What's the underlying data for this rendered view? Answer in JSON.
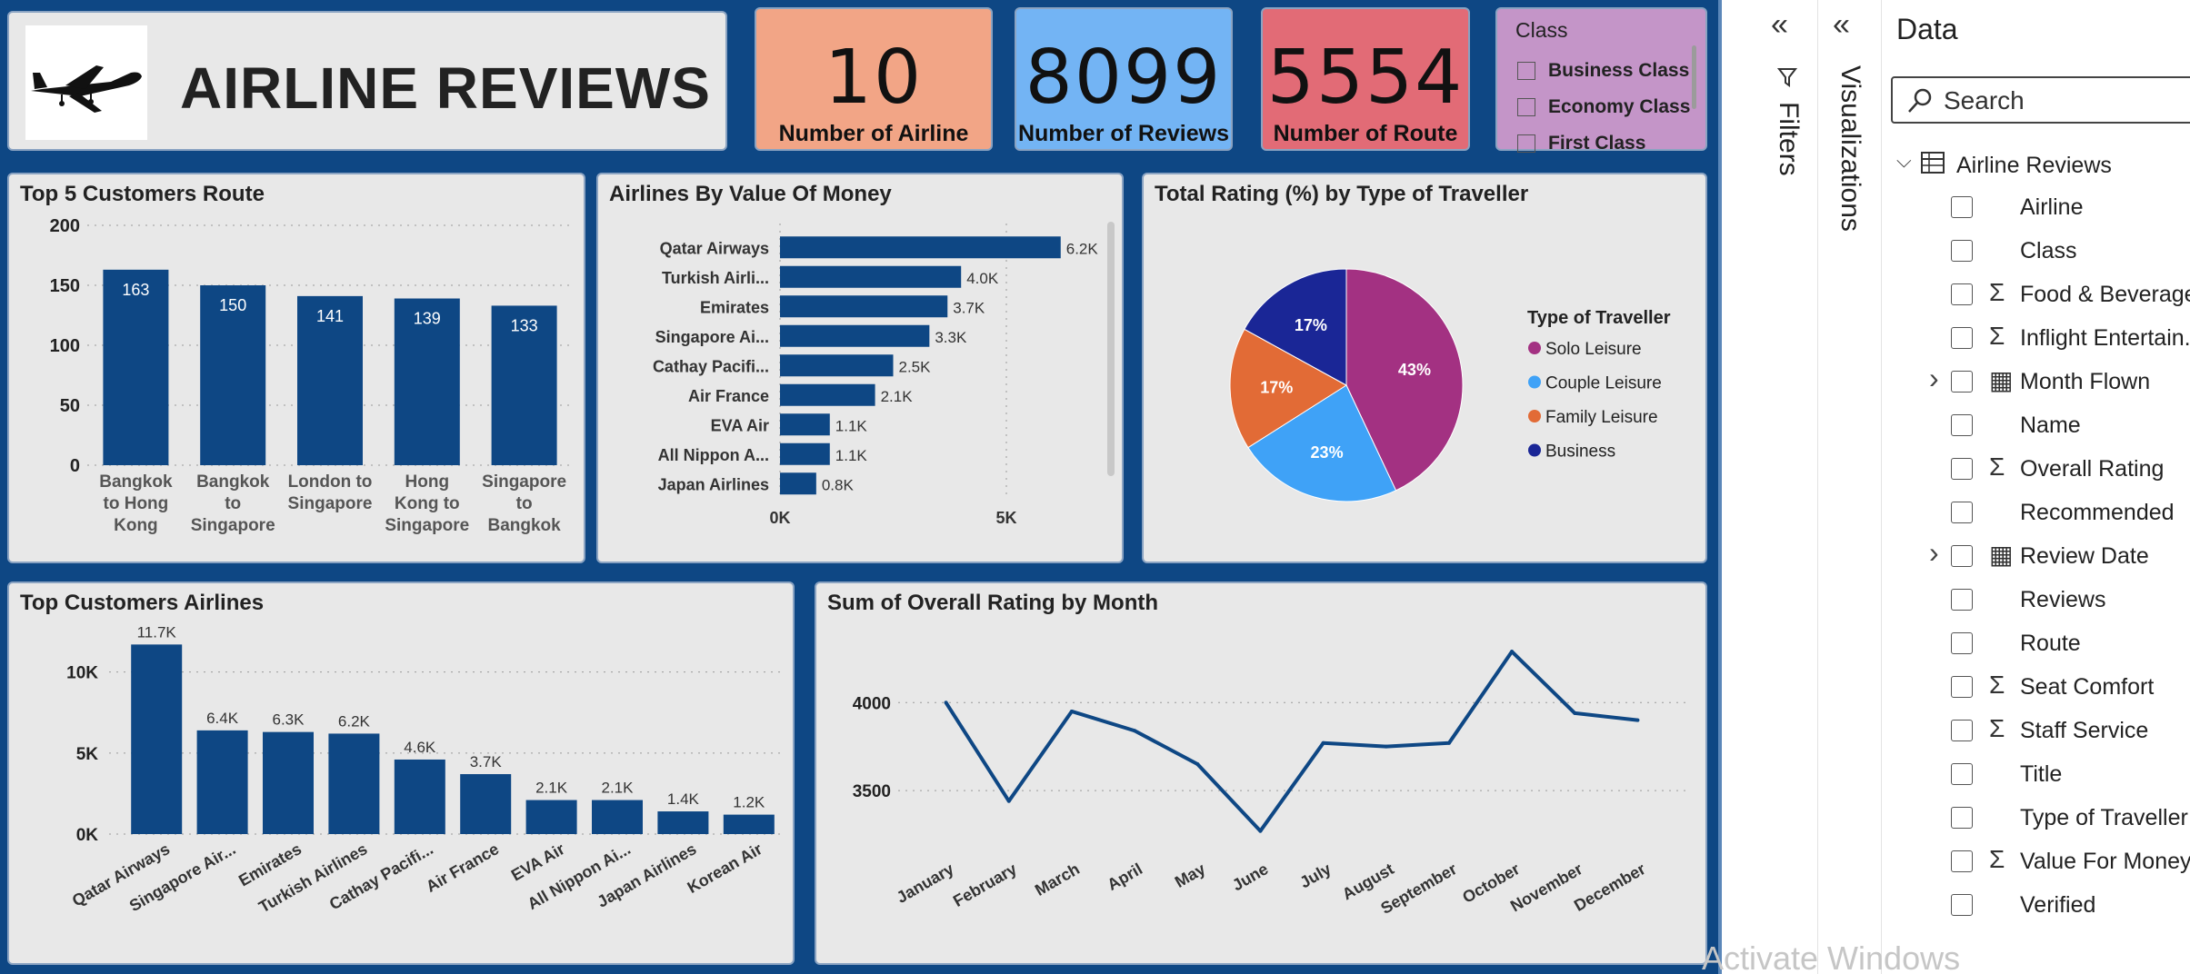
{
  "header": {
    "title": "AIRLINE REVIEWS"
  },
  "kpis": [
    {
      "value": "10",
      "label": "Number of Airline",
      "color": "#f2a586"
    },
    {
      "value": "8099",
      "label": "Number of Reviews",
      "color": "#73b4f4"
    },
    {
      "value": "5554",
      "label": "Number of Route",
      "color": "#e26b76"
    }
  ],
  "slicer": {
    "title": "Class",
    "items": [
      "Business Class",
      "Economy Class",
      "First Class"
    ]
  },
  "charts": {
    "routes": {
      "title": "Top 5 Customers Route",
      "chart_data": {
        "type": "bar",
        "categories": [
          "Bangkok to Hong Kong",
          "Bangkok to Singapore",
          "London to Singapore",
          "Hong Kong to Singapore",
          "Singapore to Bangkok"
        ],
        "category_lines": [
          [
            "Bangkok",
            "to Hong",
            "Kong"
          ],
          [
            "Bangkok",
            "to",
            "Singapore"
          ],
          [
            "London to",
            "Singapore"
          ],
          [
            "Hong",
            "Kong to",
            "Singapore"
          ],
          [
            "Singapore",
            "to",
            "Bangkok"
          ]
        ],
        "values": [
          163,
          150,
          141,
          139,
          133
        ],
        "value_labels": [
          "163",
          "150",
          "141",
          "139",
          "133"
        ],
        "yticks": [
          "0",
          "50",
          "100",
          "150",
          "200"
        ],
        "ylim": [
          0,
          200
        ],
        "color": "#0e4784"
      }
    },
    "value_money": {
      "title": "Airlines By Value Of Money",
      "chart_data": {
        "type": "bar",
        "orientation": "horizontal",
        "categories": [
          "Qatar Airways",
          "Turkish Airli...",
          "Emirates",
          "Singapore Ai...",
          "Cathay Pacifi...",
          "Air France",
          "EVA Air",
          "All Nippon A...",
          "Japan Airlines"
        ],
        "values": [
          6200,
          4000,
          3700,
          3300,
          2500,
          2100,
          1100,
          1100,
          800
        ],
        "value_labels": [
          "6.2K",
          "4.0K",
          "3.7K",
          "3.3K",
          "2.5K",
          "2.1K",
          "1.1K",
          "1.1K",
          "0.8K"
        ],
        "xticks": [
          "0K",
          "5K"
        ],
        "xlim": [
          0,
          5000
        ],
        "color": "#0e4784"
      }
    },
    "traveller": {
      "title": "Total Rating (%) by Type of Traveller",
      "chart_data": {
        "type": "pie",
        "legend_title": "Type of Traveller",
        "labels": [
          "Solo Leisure",
          "Couple Leisure",
          "Family Leisure",
          "Business"
        ],
        "values": [
          43,
          23,
          17,
          17
        ],
        "value_labels": [
          "43%",
          "23%",
          "17%",
          "17%"
        ],
        "colors": [
          "#a33182",
          "#3fa2f7",
          "#e26b36",
          "#1a2696"
        ]
      }
    },
    "airlines": {
      "title": "Top Customers Airlines",
      "chart_data": {
        "type": "bar",
        "categories": [
          "Qatar Airways",
          "Singapore Air...",
          "Emirates",
          "Turkish Airlines",
          "Cathay Pacifi...",
          "Air France",
          "EVA Air",
          "All Nippon Ai...",
          "Japan Airlines",
          "Korean Air"
        ],
        "values": [
          11700,
          6400,
          6300,
          6200,
          4600,
          3700,
          2100,
          2100,
          1400,
          1200
        ],
        "value_labels": [
          "11.7K",
          "6.4K",
          "6.3K",
          "6.2K",
          "4.6K",
          "3.7K",
          "2.1K",
          "2.1K",
          "1.4K",
          "1.2K"
        ],
        "yticks": [
          "0K",
          "5K",
          "10K"
        ],
        "ylim": [
          0,
          12000
        ],
        "color": "#0e4784"
      }
    },
    "month": {
      "title": "Sum of Overall Rating by Month",
      "chart_data": {
        "type": "line",
        "x": [
          "January",
          "February",
          "March",
          "April",
          "May",
          "June",
          "July",
          "August",
          "September",
          "October",
          "November",
          "December"
        ],
        "values": [
          4000,
          3440,
          3950,
          3840,
          3650,
          3270,
          3770,
          3750,
          3770,
          4290,
          3940,
          3900
        ],
        "yticks": [
          "3500",
          "4000"
        ],
        "ylim": [
          3180,
          4420
        ],
        "color": "#0e4784"
      }
    }
  },
  "panes": {
    "filters_label": "Filters",
    "viz_label": "Visualizations",
    "data_title": "Data",
    "search_placeholder": "Search",
    "table_name": "Airline Reviews",
    "fields": [
      {
        "name": "Airline",
        "icon": "",
        "expand": false
      },
      {
        "name": "Class",
        "icon": "",
        "expand": false
      },
      {
        "name": "Food & Beverages",
        "icon": "sigma",
        "expand": false
      },
      {
        "name": "Inflight Entertain...",
        "icon": "sigma",
        "expand": false
      },
      {
        "name": "Month Flown",
        "icon": "calendar",
        "expand": true
      },
      {
        "name": "Name",
        "icon": "",
        "expand": false
      },
      {
        "name": "Overall Rating",
        "icon": "sigma",
        "expand": false
      },
      {
        "name": "Recommended",
        "icon": "",
        "expand": false
      },
      {
        "name": "Review Date",
        "icon": "calendar",
        "expand": true
      },
      {
        "name": "Reviews",
        "icon": "",
        "expand": false
      },
      {
        "name": "Route",
        "icon": "",
        "expand": false
      },
      {
        "name": "Seat Comfort",
        "icon": "sigma",
        "expand": false
      },
      {
        "name": "Staff Service",
        "icon": "sigma",
        "expand": false
      },
      {
        "name": "Title",
        "icon": "",
        "expand": false
      },
      {
        "name": "Type of Traveller",
        "icon": "",
        "expand": false
      },
      {
        "name": "Value For Money",
        "icon": "sigma",
        "expand": false
      },
      {
        "name": "Verified",
        "icon": "",
        "expand": false
      }
    ]
  },
  "watermark": "Activate Windows"
}
